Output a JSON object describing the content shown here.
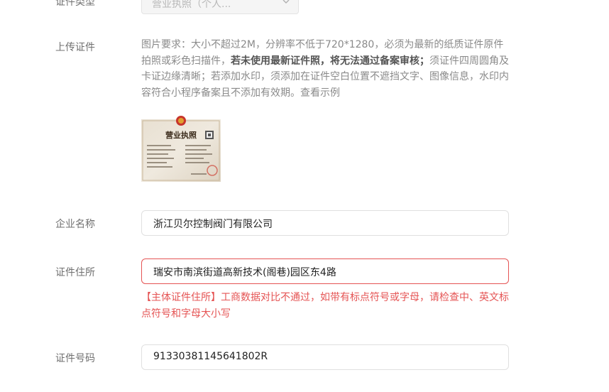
{
  "form": {
    "cert_type": {
      "label": "证件类型",
      "value": "营业执照（个人..."
    },
    "upload": {
      "label": "上传证件",
      "hint_1": "图片要求：大小不超过2M，分辨率不低于720*1280，必须为最新的纸质证件原件拍照或彩色扫描件，",
      "hint_bold": "若未使用最新证件照，将无法通过备案审核；",
      "hint_2": "须证件四周圆角及卡证边缘清晰；若添加水印，须添加在证件空白位置不遮挡文字、图像信息，水印内容符合小程序备案且不添加有效期。",
      "example_link": "查看示例",
      "sample_title": "营业执照"
    },
    "company": {
      "label": "企业名称",
      "value": "浙江贝尔控制阀门有限公司"
    },
    "address": {
      "label": "证件住所",
      "value": "瑞安市南滨街道高新技术(阁巷)园区东4路",
      "error": "【主体证件住所】工商数据对比不通过，如带有标点符号或字母，请检查中、英文标点符号和字母大小写"
    },
    "cert_no": {
      "label": "证件号码",
      "value": "91330381145641802R"
    }
  },
  "colors": {
    "error": "#e55454",
    "label": "#707070",
    "hint": "#8a8a8a",
    "border": "#e0e0e0"
  }
}
